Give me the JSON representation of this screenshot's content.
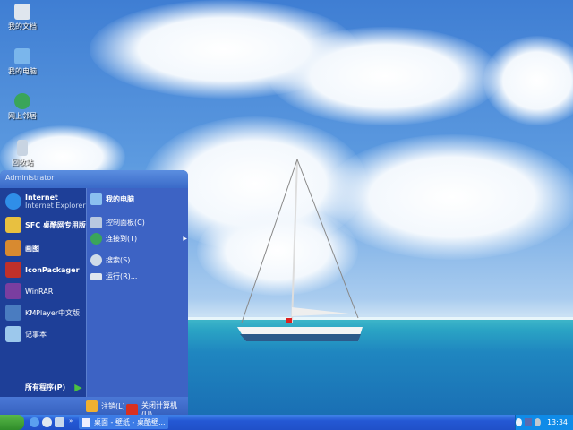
{
  "desktop": {
    "icons": [
      {
        "label": "我的文档",
        "icon": "documents-icon"
      },
      {
        "label": "我的电脑",
        "icon": "computer-icon"
      },
      {
        "label": "网上邻居",
        "icon": "network-icon"
      },
      {
        "label": "回收站",
        "icon": "recycle-bin-icon"
      }
    ]
  },
  "start_menu": {
    "user": "Administrator",
    "left_items": [
      {
        "label": "Internet",
        "sub": "Internet Explorer",
        "icon": "ie-icon"
      },
      {
        "label": "SFC 桌酷网专用版",
        "icon": "sfc-icon"
      },
      {
        "label": "画图",
        "icon": "paint-icon"
      },
      {
        "label": "IconPackager",
        "icon": "iconpackager-icon"
      },
      {
        "label": "WinRAR",
        "icon": "winrar-icon"
      },
      {
        "label": "KMPlayer中文版",
        "icon": "kmplayer-icon"
      },
      {
        "label": "记事本",
        "icon": "notepad-icon"
      }
    ],
    "all_programs": "所有程序(P)",
    "right_items": [
      {
        "label": "我的电脑",
        "icon": "computer-icon"
      },
      {
        "label": "控制面板(C)",
        "icon": "control-panel-icon"
      },
      {
        "label": "连接到(T)",
        "icon": "connect-icon"
      },
      {
        "label": "搜索(S)",
        "icon": "search-icon"
      },
      {
        "label": "运行(R)...",
        "icon": "run-icon"
      }
    ],
    "logoff": "注销(L)",
    "shutdown": "关闭计算机(U)"
  },
  "taskbar": {
    "task": "桌面 - 壁纸 - 桌酷壁...",
    "clock": "13:34"
  }
}
